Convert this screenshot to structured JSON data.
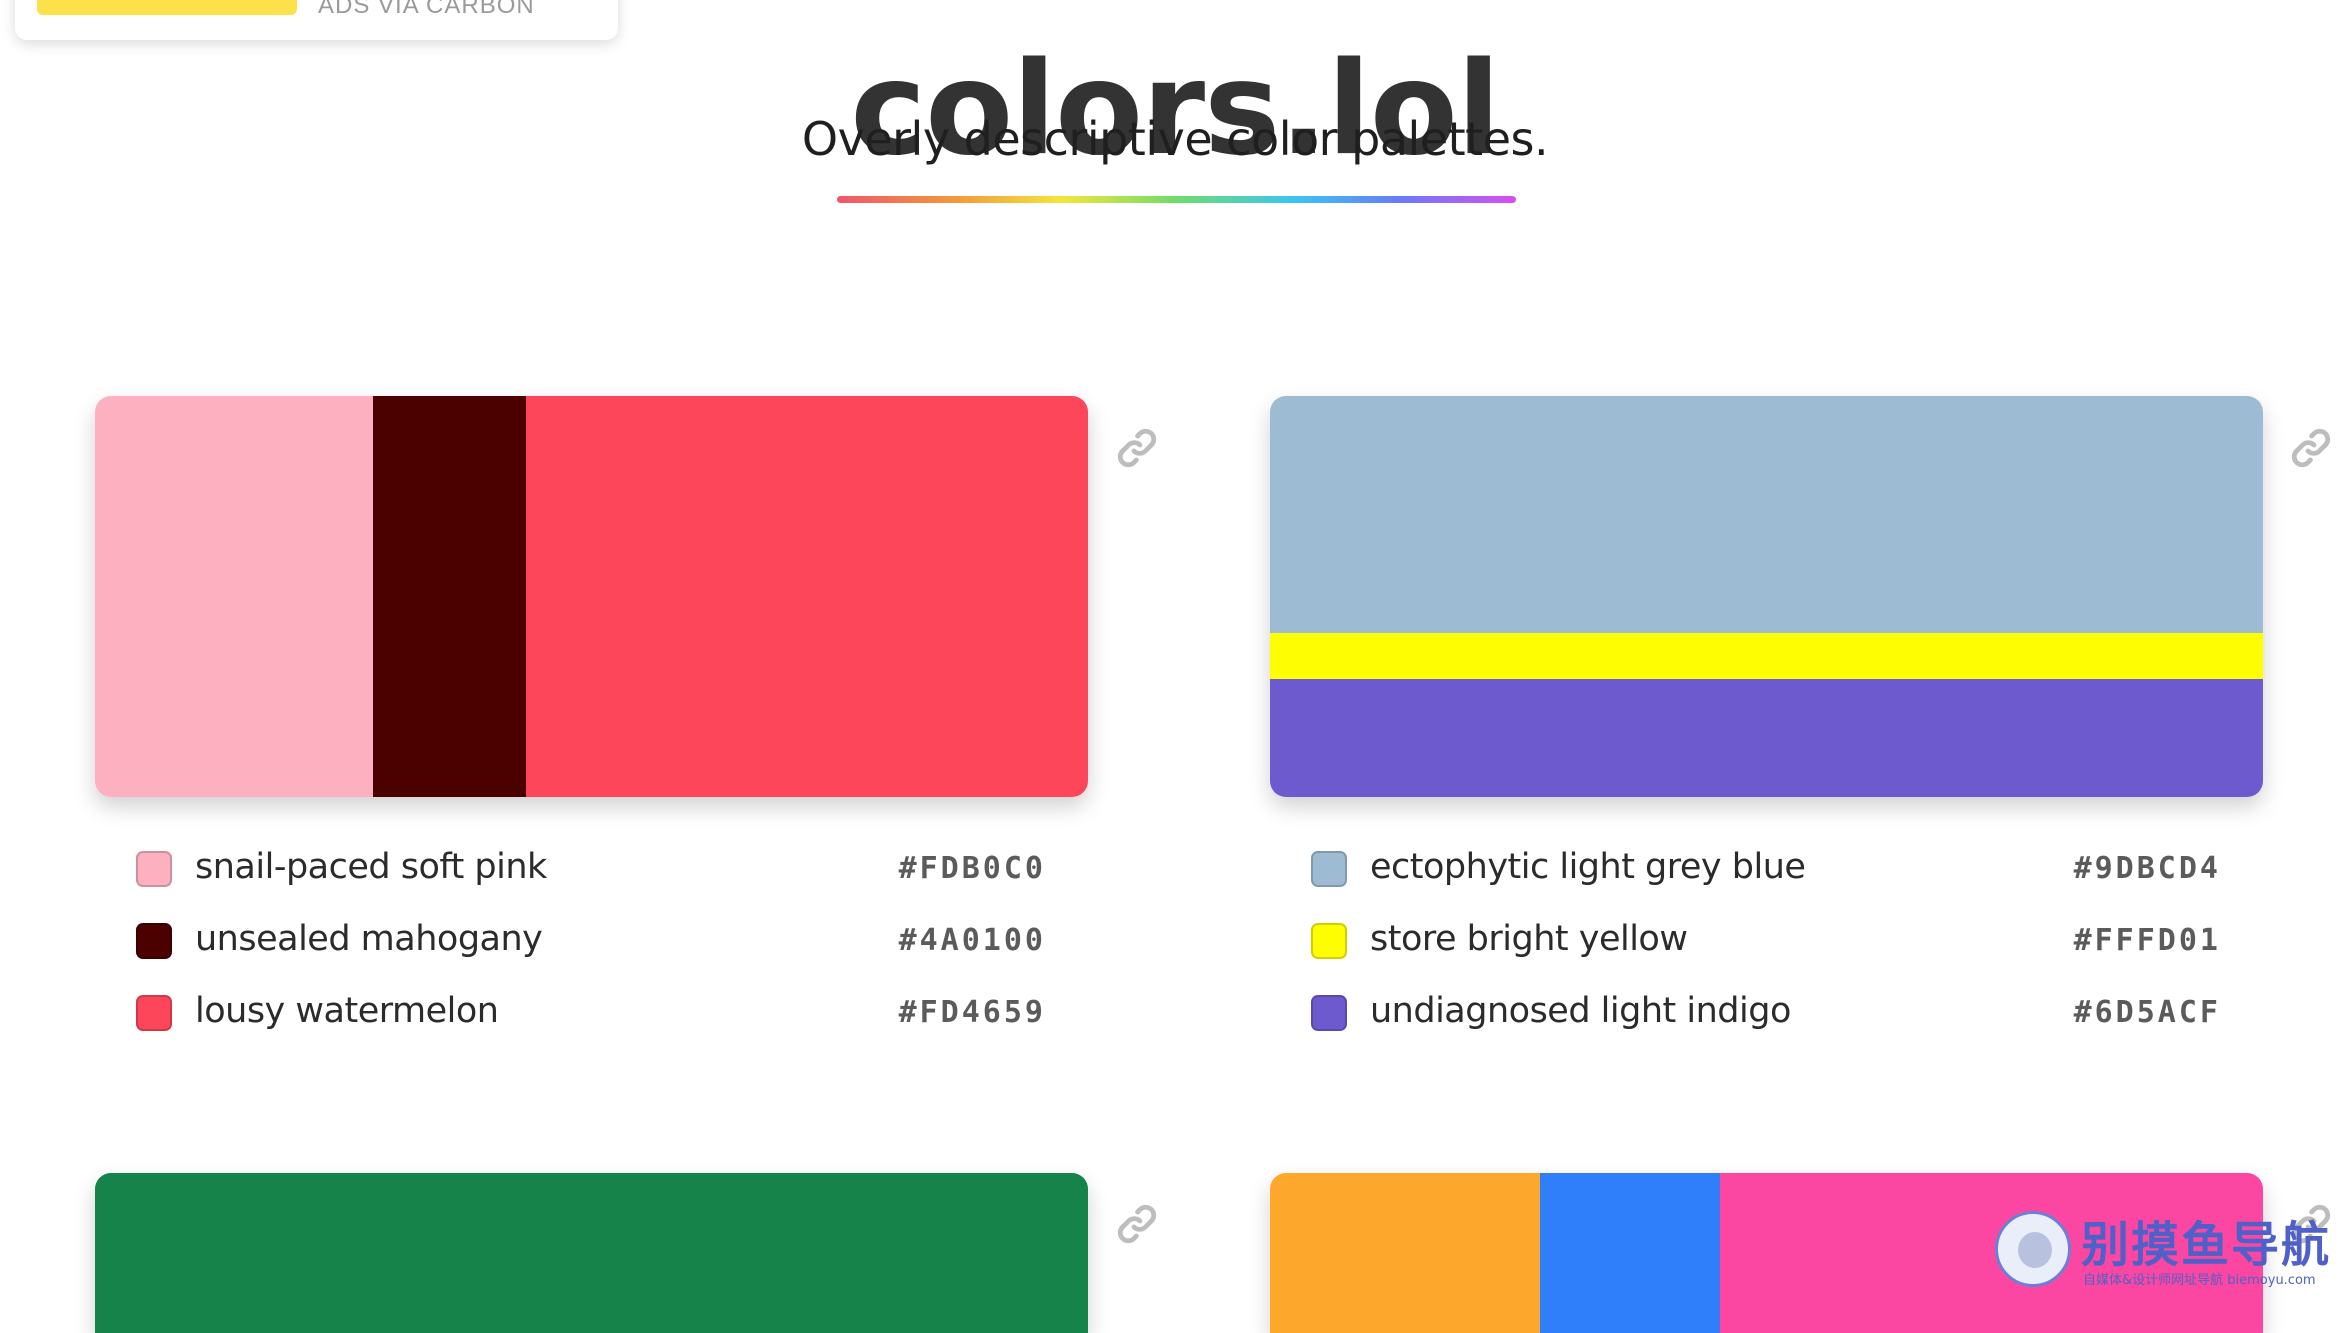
{
  "ad": {
    "label": "ADS VIA CARBON"
  },
  "header": {
    "title": "colors.lol",
    "subtitle": "Overly descriptive color palettes."
  },
  "palettes": [
    {
      "orientation": "vertical",
      "bands": [
        {
          "color": "#FDB0C0",
          "share": 0.28
        },
        {
          "color": "#4A0100",
          "share": 0.154
        },
        {
          "color": "#FD4659",
          "share": 0.566
        }
      ],
      "colors": [
        {
          "name": "snail-paced soft pink",
          "hex": "#FDB0C0"
        },
        {
          "name": "unsealed mahogany",
          "hex": "#4A0100"
        },
        {
          "name": "lousy watermelon",
          "hex": "#FD4659"
        }
      ]
    },
    {
      "orientation": "horizontal",
      "bands": [
        {
          "color": "#9DBCD4",
          "share": 0.59
        },
        {
          "color": "#FFFD01",
          "share": 0.115
        },
        {
          "color": "#6D5ACF",
          "share": 0.295
        }
      ],
      "colors": [
        {
          "name": "ectophytic light grey blue",
          "hex": "#9DBCD4"
        },
        {
          "name": "store bright yellow",
          "hex": "#FFFD01"
        },
        {
          "name": "undiagnosed light indigo",
          "hex": "#6D5ACF"
        }
      ]
    },
    {
      "orientation": "vertical",
      "bands": [
        {
          "color": "#15834A",
          "share": 1.0
        }
      ],
      "colors": []
    },
    {
      "orientation": "vertical",
      "bands": [
        {
          "color": "#FDA82C",
          "share": 0.272
        },
        {
          "color": "#2F7FFB",
          "share": 0.181
        },
        {
          "color": "#FB47A1",
          "share": 0.547
        }
      ],
      "colors": []
    }
  ],
  "watermark": {
    "text": "别摸鱼导航",
    "subtext": "自媒体&设计师网址导航 biemoyu.com"
  },
  "icons": {
    "link": "link-icon"
  },
  "colors": {
    "title": "#333333",
    "link_icon": "#BDBDBD",
    "watermark": "#5060C9"
  }
}
